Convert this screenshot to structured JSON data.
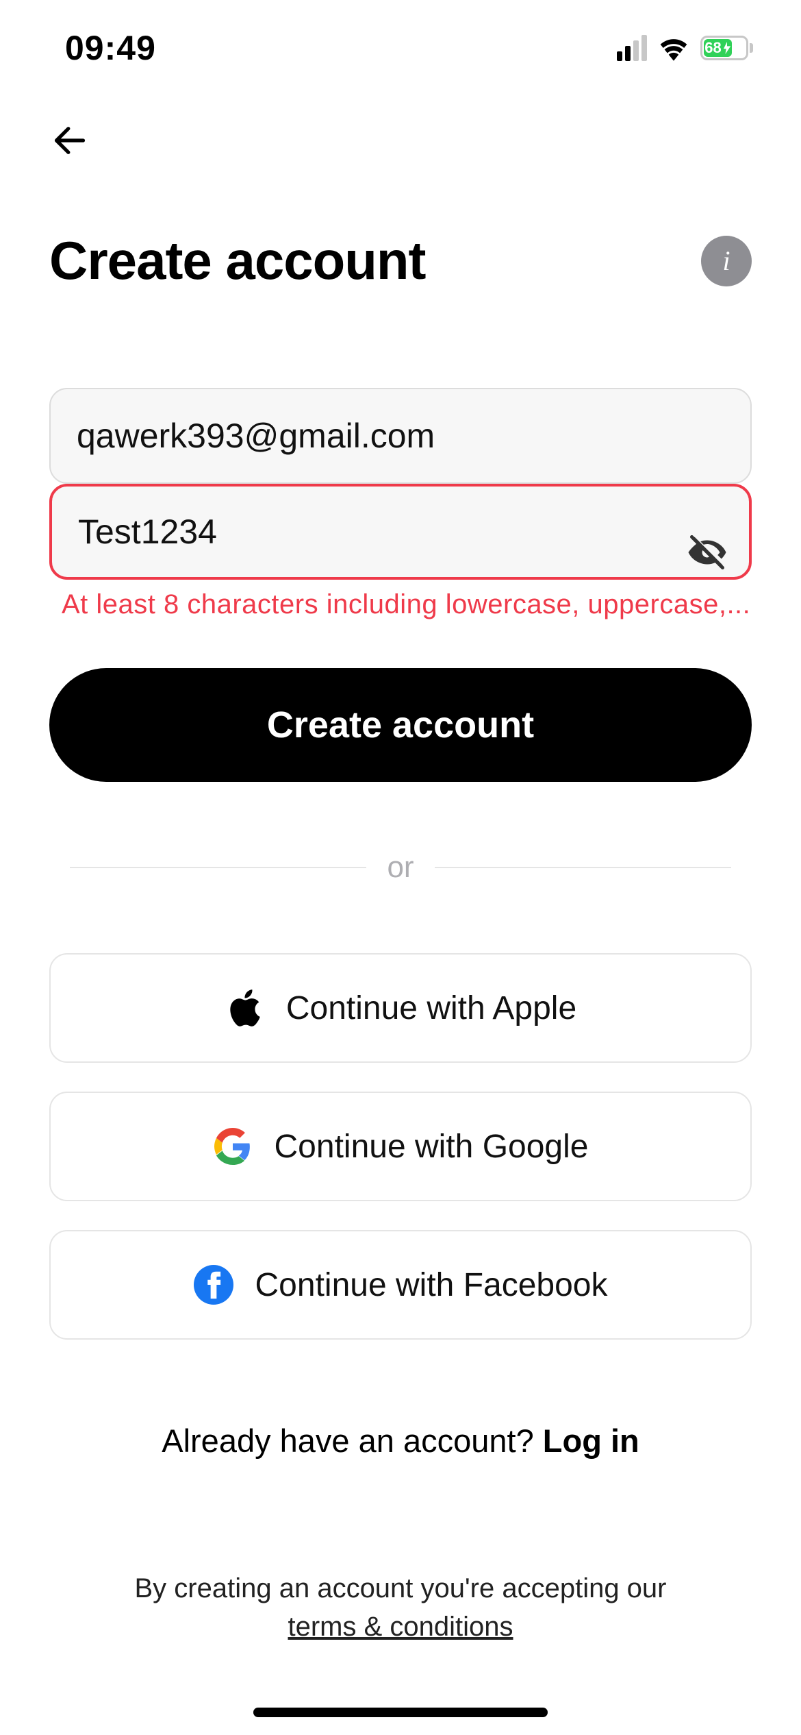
{
  "status": {
    "time": "09:49",
    "battery_pct": "68"
  },
  "nav": {
    "back": "Back"
  },
  "header": {
    "title": "Create account",
    "info": "i"
  },
  "form": {
    "email": {
      "value": "qawerk393@gmail.com"
    },
    "password": {
      "value": "Test1234",
      "error": "At least 8 characters including lowercase, uppercase,..."
    },
    "submit_label": "Create account"
  },
  "divider_label": "or",
  "social": {
    "apple": "Continue with Apple",
    "google": "Continue with Google",
    "facebook": "Continue with Facebook"
  },
  "login_prompt": {
    "text": "Already have an account? ",
    "link": "Log in"
  },
  "terms": {
    "text": "By creating an account you're accepting our",
    "link": "terms & conditions"
  }
}
